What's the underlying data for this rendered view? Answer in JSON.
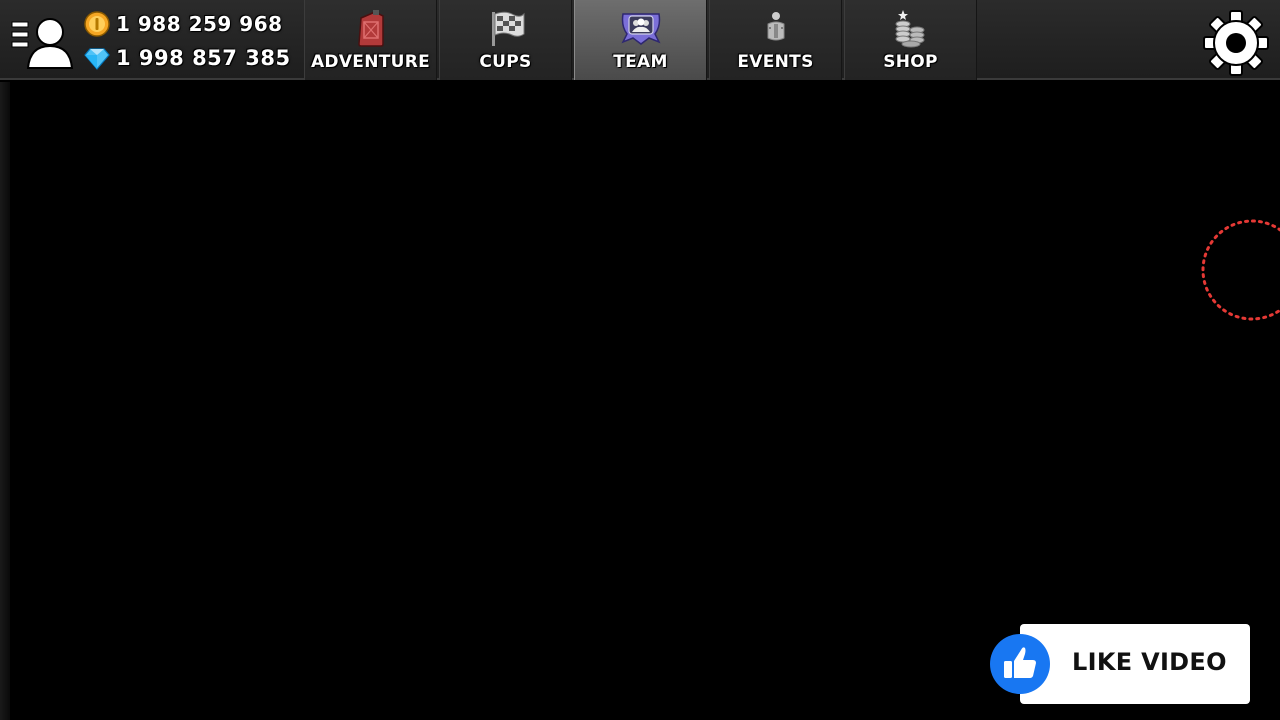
{
  "currency": {
    "coins": "1 988 259 968",
    "gems": "1 998 857 385"
  },
  "tabs": [
    {
      "label": "ADVENTURE",
      "icon": "fuel-can-icon",
      "active": false
    },
    {
      "label": "CUPS",
      "icon": "checkered-flag-icon",
      "active": false
    },
    {
      "label": "TEAM",
      "icon": "team-badge-icon",
      "active": true
    },
    {
      "label": "EVENTS",
      "icon": "events-icon",
      "active": false
    },
    {
      "label": "SHOP",
      "icon": "coin-stack-icon",
      "active": false
    }
  ],
  "overlay": {
    "like_label": "LIKE VIDEO"
  },
  "colors": {
    "background": "#000000",
    "topbar": "#262626",
    "active_tab": "#5e5e5e",
    "coin": "#f5a623",
    "gem": "#4fc3f7",
    "like_blue": "#1877f2",
    "spinner": "#e53935"
  }
}
